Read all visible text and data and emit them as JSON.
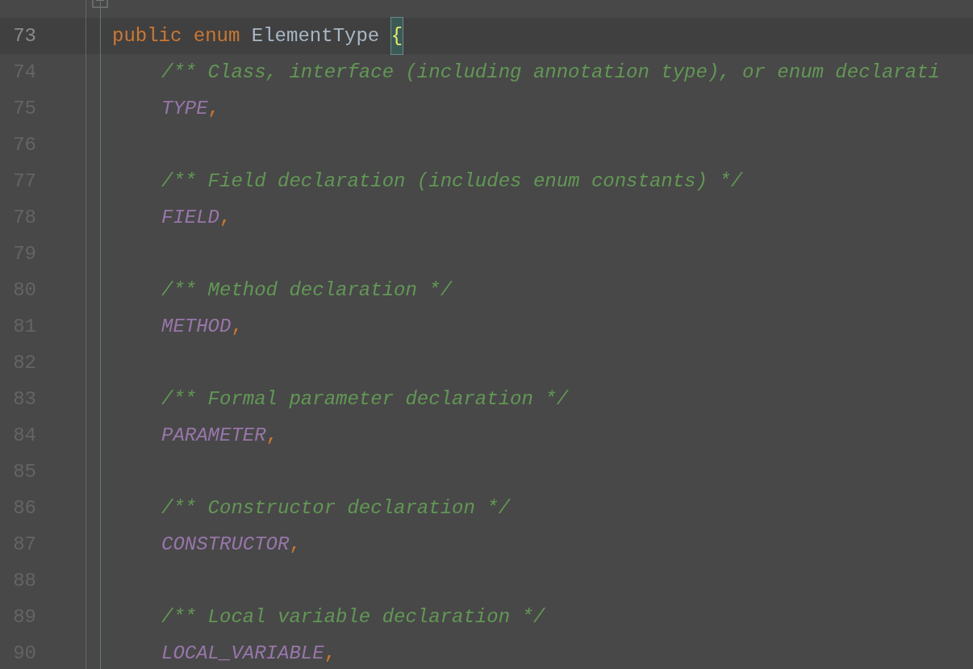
{
  "editor": {
    "lines": [
      {
        "number": "73",
        "kind": "declaration",
        "current": true,
        "tokens": [
          {
            "text": "public",
            "kind": "keyword"
          },
          {
            "text": "enum",
            "kind": "keyword"
          },
          {
            "text": "ElementType",
            "kind": "identifier"
          },
          {
            "text": "{",
            "kind": "brace"
          }
        ]
      },
      {
        "number": "74",
        "kind": "member",
        "current": false,
        "tokens": [
          {
            "text": "/** Class, interface (including annotation type), or enum declarati",
            "kind": "comment"
          }
        ]
      },
      {
        "number": "75",
        "kind": "member",
        "current": false,
        "tokens": [
          {
            "text": "TYPE",
            "kind": "constant"
          },
          {
            "text": ",",
            "kind": "punct"
          }
        ]
      },
      {
        "number": "76",
        "kind": "blank",
        "current": false
      },
      {
        "number": "77",
        "kind": "member",
        "current": false,
        "tokens": [
          {
            "text": "/** Field declaration (includes enum constants) */",
            "kind": "comment"
          }
        ]
      },
      {
        "number": "78",
        "kind": "member",
        "current": false,
        "tokens": [
          {
            "text": "FIELD",
            "kind": "constant"
          },
          {
            "text": ",",
            "kind": "punct"
          }
        ]
      },
      {
        "number": "79",
        "kind": "blank",
        "current": false
      },
      {
        "number": "80",
        "kind": "member",
        "current": false,
        "tokens": [
          {
            "text": "/** Method declaration */",
            "kind": "comment"
          }
        ]
      },
      {
        "number": "81",
        "kind": "member",
        "current": false,
        "tokens": [
          {
            "text": "METHOD",
            "kind": "constant"
          },
          {
            "text": ",",
            "kind": "punct"
          }
        ]
      },
      {
        "number": "82",
        "kind": "blank",
        "current": false
      },
      {
        "number": "83",
        "kind": "member",
        "current": false,
        "tokens": [
          {
            "text": "/** Formal parameter declaration */",
            "kind": "comment"
          }
        ]
      },
      {
        "number": "84",
        "kind": "member",
        "current": false,
        "tokens": [
          {
            "text": "PARAMETER",
            "kind": "constant"
          },
          {
            "text": ",",
            "kind": "punct"
          }
        ]
      },
      {
        "number": "85",
        "kind": "blank",
        "current": false
      },
      {
        "number": "86",
        "kind": "member",
        "current": false,
        "tokens": [
          {
            "text": "/** Constructor declaration */",
            "kind": "comment"
          }
        ]
      },
      {
        "number": "87",
        "kind": "member",
        "current": false,
        "tokens": [
          {
            "text": "CONSTRUCTOR",
            "kind": "constant"
          },
          {
            "text": ",",
            "kind": "punct"
          }
        ]
      },
      {
        "number": "88",
        "kind": "blank",
        "current": false
      },
      {
        "number": "89",
        "kind": "member",
        "current": false,
        "tokens": [
          {
            "text": "/** Local variable declaration */",
            "kind": "comment"
          }
        ]
      },
      {
        "number": "90",
        "kind": "member",
        "current": false,
        "tokens": [
          {
            "text": "LOCAL_VARIABLE",
            "kind": "constant"
          },
          {
            "text": ",",
            "kind": "punct"
          }
        ]
      }
    ]
  }
}
